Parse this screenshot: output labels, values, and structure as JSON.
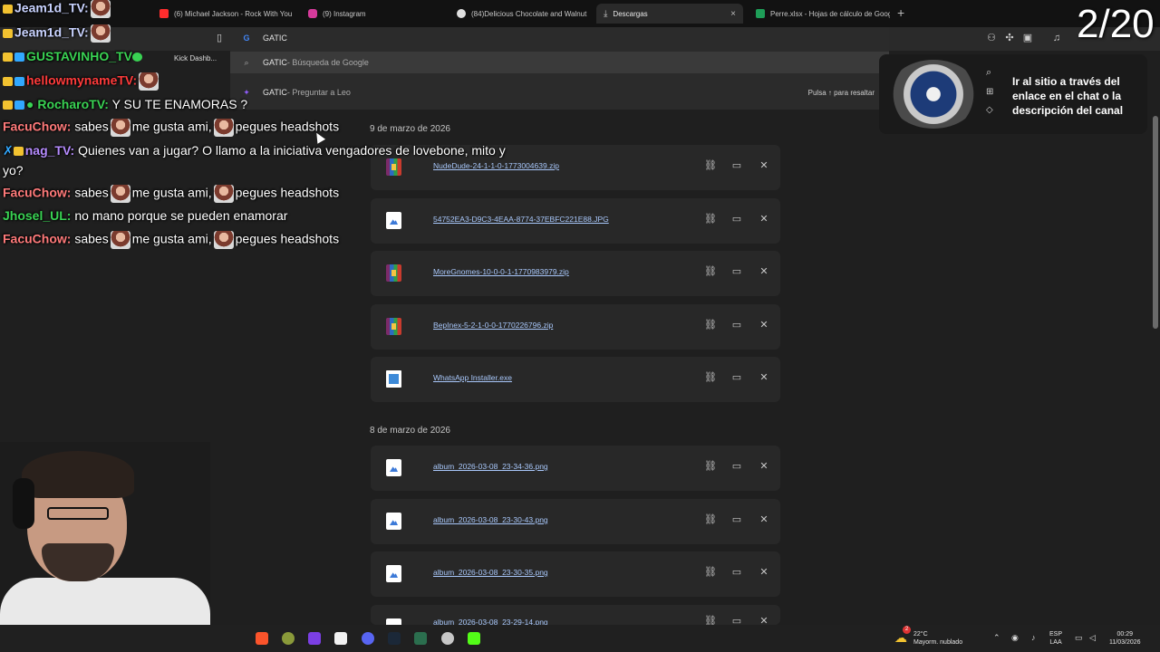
{
  "browser": {
    "tabs": [
      {
        "label": "(6) Michael Jackson - Rock With You",
        "icon": "youtube-icon",
        "color": "#ff2d2d"
      },
      {
        "label": "(9) Instagram",
        "icon": "instagram-icon",
        "color": "#d63a9b"
      },
      {
        "label": "(84)Delicious Chocolate and Walnut",
        "icon": "tiktok-icon",
        "color": "#e0e0e0"
      },
      {
        "label": "Descargas",
        "icon": "download-icon",
        "color": "#c7c7c7",
        "close": "×"
      },
      {
        "label": "Perre.xlsx - Hojas de cálculo de Goog",
        "icon": "sheets-icon",
        "color": "#1e9e58"
      }
    ],
    "new_tab": "+",
    "bookmark_label": "Kick Dashb..."
  },
  "omnibox": {
    "query": "GATIC",
    "suggestions": [
      {
        "text": "GATIC",
        "suffix": " - Búsqueda de Google",
        "icon": "search-icon"
      },
      {
        "text": "GATIC",
        "suffix": " - Preguntar a Leo",
        "icon": "leo-icon"
      }
    ],
    "hint": "Pulsa ↑ para resaltar"
  },
  "downloads": {
    "groups": [
      {
        "date": "9 de marzo de 2026",
        "items": [
          {
            "name": "NudeDude-24-1-1-0-1773004639.zip",
            "type": "archive"
          },
          {
            "name": "54752EA3-D9C3-4EAA-8774-37EBFC221E88.JPG",
            "type": "image"
          },
          {
            "name": "MoreGnomes-10-0-0-1-1770983979.zip",
            "type": "archive"
          },
          {
            "name": "BepInex-5-2-1-0-0-1770226796.zip",
            "type": "archive"
          },
          {
            "name": "WhatsApp Installer.exe",
            "type": "exe"
          }
        ]
      },
      {
        "date": "8 de marzo de 2026",
        "items": [
          {
            "name": "album_2026-03-08_23-34-36.png",
            "type": "image"
          },
          {
            "name": "album_2026-03-08_23-30-43.png",
            "type": "image"
          },
          {
            "name": "album_2026-03-08_23-30-35.png",
            "type": "image"
          },
          {
            "name": "album_2026-03-08_23-29-14.png",
            "type": "image"
          }
        ]
      }
    ],
    "actions": {
      "copy_link": "⛓",
      "show_folder": "▭",
      "remove": "✕"
    }
  },
  "chat": {
    "messages": [
      {
        "user": "Jeam1d_TV:",
        "text": "",
        "color": "#c9d3ff",
        "emote": true
      },
      {
        "user": "Jeam1d_TV:",
        "text": "",
        "color": "#c9d3ff",
        "emote": true
      },
      {
        "user": "GUSTAVINHO_TV",
        "text": "",
        "color": "#39d353",
        "emote": false
      },
      {
        "user": "hellowmynameTV:",
        "text": "",
        "color": "#ff3b3b",
        "emote": true
      },
      {
        "user": "RocharoTV:",
        "text": "Y SU TE ENAMORAS ?",
        "color": "#39d353",
        "emote": false
      },
      {
        "user": "FacuChow:",
        "text_a": "sabes",
        "text_b": "me gusta ami,",
        "text_c": "pegues headshots",
        "color": "#ff7a7a",
        "emote": true
      },
      {
        "user": "nag_TV:",
        "text": "Quienes van a jugar? O llamo a la iniciativa vengadores de lovebone, mito y",
        "color": "#b68cff",
        "emote": false
      },
      {
        "user": "",
        "text": "yo?",
        "color": "#ffffff",
        "emote": false
      },
      {
        "user": "FacuChow:",
        "text_a": "sabes",
        "text_b": "me gusta ami,",
        "text_c": "pegues headshots",
        "color": "#ff7a7a",
        "emote": true
      },
      {
        "user": "Jhosel_UL:",
        "text": "no mano porque se pueden enamorar",
        "color": "#39d353",
        "emote": false
      },
      {
        "user": "FacuChow:",
        "text_a": "sabes",
        "text_b": "me gusta ami,",
        "text_c": "pegues headshots",
        "color": "#ff7a7a",
        "emote": true
      }
    ]
  },
  "overlay": {
    "counter": "2/20",
    "ad_text": "Ir al sitio a través del enlace en el chat o la descripción del canal"
  },
  "taskbar": {
    "weather_temp": "22°C",
    "weather_desc": "Mayorm. nublado",
    "lang_line1": "ESP",
    "lang_line2": "LAA",
    "time": "00:29",
    "date": "11/03/2026",
    "badge_count": "2"
  }
}
